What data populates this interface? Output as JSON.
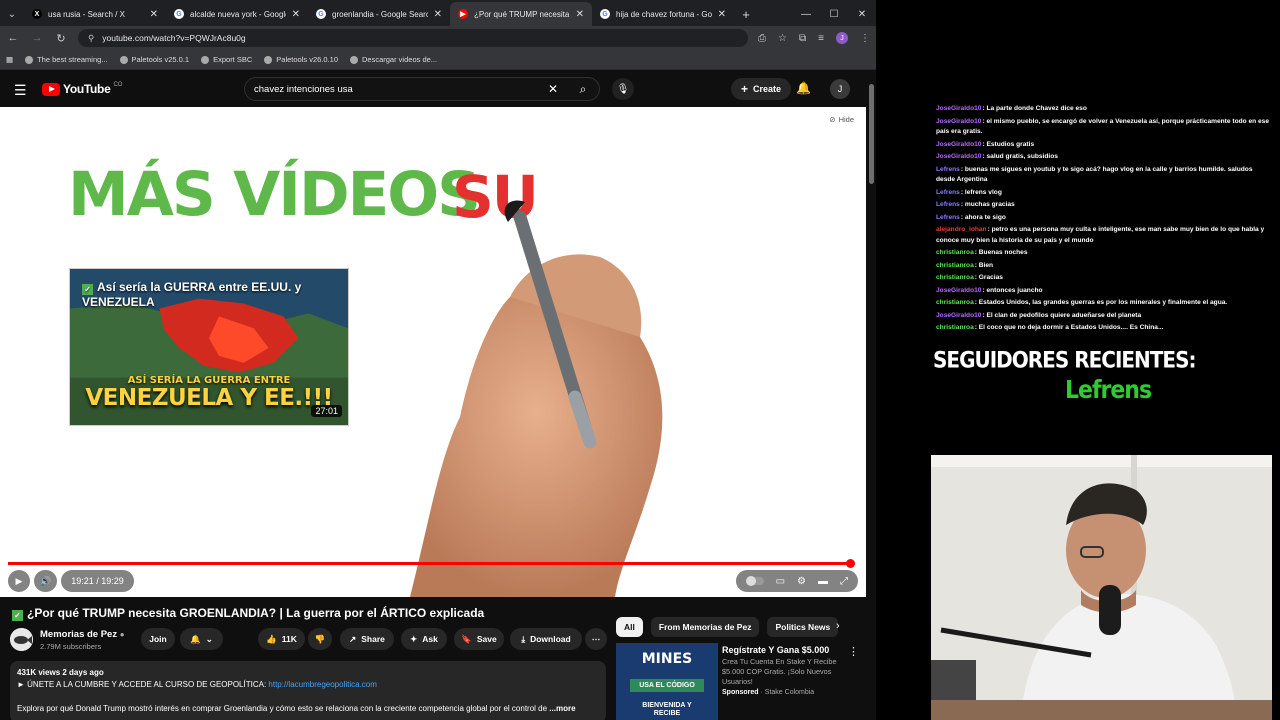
{
  "browser": {
    "tabs": [
      {
        "title": "usa rusia - Search / X",
        "icon": "x-icon",
        "active": false
      },
      {
        "title": "alcalde nueva york - Google Se",
        "icon": "google-icon",
        "active": false
      },
      {
        "title": "groenlandia - Google Search",
        "icon": "google-icon",
        "active": false
      },
      {
        "title": "¿Por qué TRUMP necesita G",
        "icon": "youtube-icon",
        "active": true
      },
      {
        "title": "hija de chavez fortuna - Googl",
        "icon": "google-icon",
        "active": false
      }
    ],
    "url": "youtube.com/watch?v=PQWJrAc8u0g",
    "profile_initial": "J",
    "bookmarks": [
      {
        "label": "The best streaming..."
      },
      {
        "label": "Paletools v25.0.1"
      },
      {
        "label": "Export SBC"
      },
      {
        "label": "Paletools v26.0.10"
      },
      {
        "label": "Descargar videos de..."
      }
    ]
  },
  "youtube": {
    "logo_text": "YouTube",
    "country_code": "CO",
    "search_value": "chavez intenciones usa",
    "create_label": "Create",
    "user_initial": "J"
  },
  "player": {
    "hide_label": "Hide",
    "endscreen_title": "MÁS VÍDEOS",
    "endscreen_subscribe": "SU",
    "endcard": {
      "title": "Así sería la GUERRA entre EE.UU. y VENEZUELA",
      "overlay_sub": "ASÍ SERÍA LA GUERRA ENTRE",
      "overlay_big": "VENEZUELA Y EE.!!!",
      "duration": "27:01"
    },
    "time": "19:21 / 19:29",
    "progress_fraction": 0.9932
  },
  "video": {
    "title": "¿Por qué TRUMP necesita GROENLANDIA? | La guerra por el ÁRTICO explicada",
    "channel_name": "Memorias de Pez",
    "subscribers": "2.79M subscribers",
    "join_label": "Join",
    "likes": "11K",
    "share_label": "Share",
    "ask_label": "Ask",
    "save_label": "Save",
    "download_label": "Download",
    "views_date": "431K views  2 days ago",
    "desc_link_prefix": "► ÚNETE A LA CUMBRE Y ACCEDE AL CURSO DE GEOPOLÍTICA: ",
    "desc_link": "http://lacumbregeopolitica.com",
    "desc_text": "Explora por qué Donald Trump mostró interés en comprar Groenlandia y cómo esto se relaciona con la creciente competencia global por el control de",
    "more_label": "...more"
  },
  "recommendations": {
    "chips": [
      "All",
      "From Memorias de Pez",
      "Politics News"
    ],
    "ad": {
      "thumb_title": "MINES",
      "thumb_sub": "USA EL CÓDIGO",
      "thumb_sub2": "BIENVENIDA Y RECIBE",
      "title": "Regístrate Y Gana $5.000",
      "description": "Crea Tu Cuenta En Stake Y Recibe $5.000 COP Gratis. ¡Solo Nuevos Usuarios!",
      "sponsored": "Sponsored",
      "advertiser": "· Stake Colombia"
    }
  },
  "overlay": {
    "chat": [
      {
        "user": "JoseGiraldo10",
        "color": "#b36cff",
        "text": ": La parte donde Chavez dice eso"
      },
      {
        "user": "JoseGiraldo10",
        "color": "#b36cff",
        "text": ": el mismo pueblo, se encargó de volver a Venezuela así, porque prácticamente todo en ese país era gratis."
      },
      {
        "user": "JoseGiraldo10",
        "color": "#b36cff",
        "text": ": Estudios gratis"
      },
      {
        "user": "JoseGiraldo10",
        "color": "#b36cff",
        "text": ": salud gratis, subsidios"
      },
      {
        "user": "Lefrens",
        "color": "#8a7cff",
        "text": ": buenas me sigues en youtub y te sigo acá? hago vlog en la calle y barrios humilde. saludos desde Argentina"
      },
      {
        "user": "Lefrens",
        "color": "#8a7cff",
        "text": ": lefrens vlog"
      },
      {
        "user": "Lefrens",
        "color": "#8a7cff",
        "text": ": muchas gracias"
      },
      {
        "user": "Lefrens",
        "color": "#8a7cff",
        "text": ": ahora te sigo"
      },
      {
        "user": "alejandro_lohan",
        "color": "#e0403a",
        "text": ": petro es una persona muy culta e inteligente, ese man sabe muy bien de lo que habla y conoce muy bien la historia de su país y el mundo"
      },
      {
        "user": "christianroa",
        "color": "#5ce65c",
        "text": ": Buenas noches"
      },
      {
        "user": "christianroa",
        "color": "#5ce65c",
        "text": ": Bien"
      },
      {
        "user": "christianroa",
        "color": "#5ce65c",
        "text": ": Gracias"
      },
      {
        "user": "JoseGiraldo10",
        "color": "#b36cff",
        "text": ": entonces juancho"
      },
      {
        "user": "christianroa",
        "color": "#5ce65c",
        "text": ": Estados Unidos, las grandes guerras es por los minerales y finalmente el agua."
      },
      {
        "user": "JoseGiraldo10",
        "color": "#b36cff",
        "text": ": El clan de pedofilos quiere adueñarse del planeta"
      },
      {
        "user": "christianroa",
        "color": "#5ce65c",
        "text": ": El coco que no deja dormir a Estados Unidos.... Es China..."
      }
    ],
    "followers_title": "SEGUIDORES RECIENTES:",
    "recent_follower": "Lefrens"
  }
}
